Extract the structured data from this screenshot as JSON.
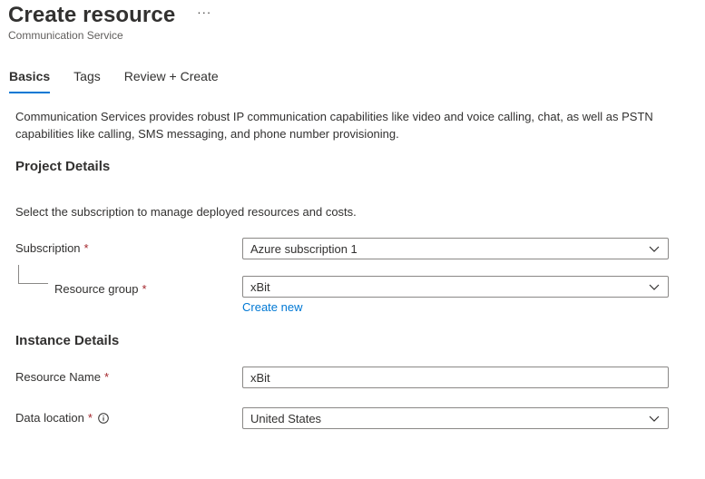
{
  "header": {
    "title": "Create resource",
    "more_label": "···",
    "subtitle": "Communication Service"
  },
  "tabs": [
    {
      "label": "Basics",
      "active": true
    },
    {
      "label": "Tags",
      "active": false
    },
    {
      "label": "Review + Create",
      "active": false
    }
  ],
  "description": "Communication Services provides robust IP communication capabilities like video and voice calling, chat, as well as PSTN capabilities like calling, SMS messaging, and phone number provisioning.",
  "project_details": {
    "heading": "Project Details",
    "helper": "Select the subscription to manage deployed resources and costs.",
    "subscription": {
      "label": "Subscription",
      "required_mark": "*",
      "value": "Azure subscription 1"
    },
    "resource_group": {
      "label": "Resource group",
      "required_mark": "*",
      "value": "xBit",
      "create_new_label": "Create new"
    }
  },
  "instance_details": {
    "heading": "Instance Details",
    "resource_name": {
      "label": "Resource Name",
      "required_mark": "*",
      "value": "xBit"
    },
    "data_location": {
      "label": "Data location",
      "required_mark": "*",
      "info_icon": "info-icon",
      "value": "United States"
    }
  },
  "colors": {
    "accent": "#0078d4",
    "required": "#a4262c",
    "border": "#8a8886",
    "text": "#323130"
  }
}
